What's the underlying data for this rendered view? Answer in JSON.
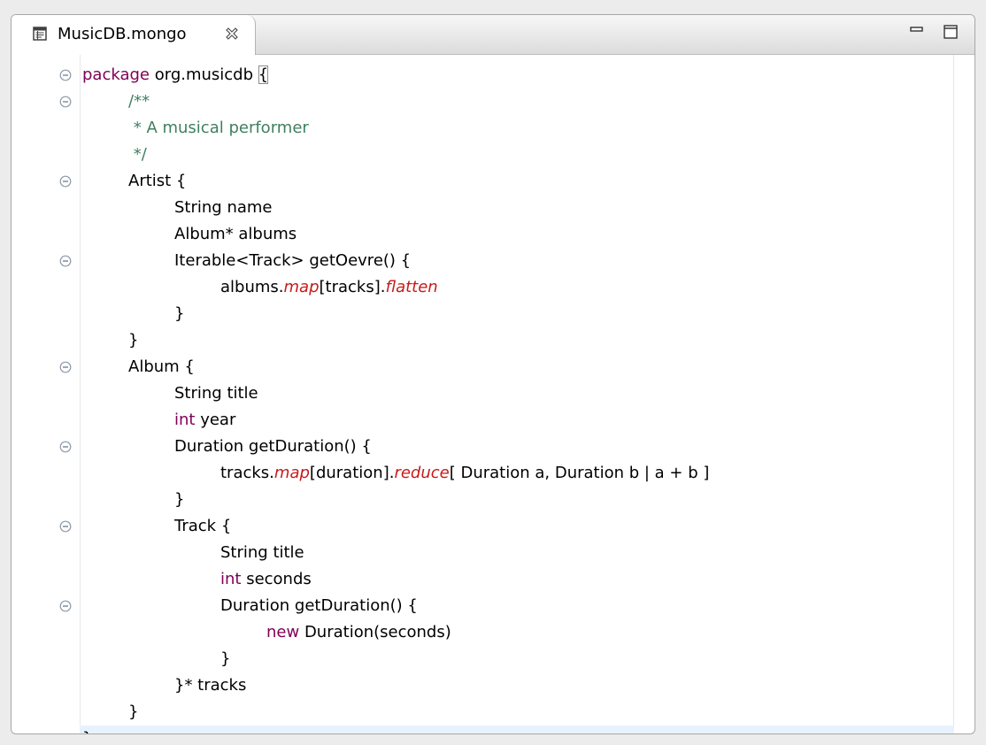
{
  "editor": {
    "tab": {
      "title": "MusicDB.mongo",
      "file_icon": "file-icon",
      "close_icon": "close-icon"
    },
    "window_controls": [
      {
        "name": "minimize-icon"
      },
      {
        "name": "maximize-icon"
      }
    ],
    "colors": {
      "keyword": "#7f0055",
      "comment": "#3f7f5f",
      "extension_method": "#c81a1a",
      "current_line": "#e8f2fe"
    },
    "code_lines": [
      {
        "indent": 0,
        "fold": true,
        "parts": [
          {
            "t": "package",
            "c": "kw"
          },
          {
            "t": " org.musicdb "
          },
          {
            "t": "{",
            "c": "bracket-match"
          }
        ]
      },
      {
        "indent": 1,
        "fold": true,
        "parts": [
          {
            "t": "/**",
            "c": "cm"
          }
        ]
      },
      {
        "indent": 1,
        "fold": false,
        "parts": [
          {
            "t": " * A musical performer",
            "c": "cm"
          }
        ]
      },
      {
        "indent": 1,
        "fold": false,
        "parts": [
          {
            "t": " */",
            "c": "cm"
          }
        ]
      },
      {
        "indent": 1,
        "fold": true,
        "parts": [
          {
            "t": "Artist {"
          }
        ]
      },
      {
        "indent": 2,
        "fold": false,
        "parts": [
          {
            "t": "String name"
          }
        ]
      },
      {
        "indent": 2,
        "fold": false,
        "parts": [
          {
            "t": "Album* albums"
          }
        ]
      },
      {
        "indent": 2,
        "fold": true,
        "parts": [
          {
            "t": "Iterable<Track> getOevre() {"
          }
        ]
      },
      {
        "indent": 3,
        "fold": false,
        "parts": [
          {
            "t": "albums."
          },
          {
            "t": "map",
            "c": "ext"
          },
          {
            "t": "[tracks]."
          },
          {
            "t": "flatten",
            "c": "ext"
          }
        ]
      },
      {
        "indent": 2,
        "fold": false,
        "parts": [
          {
            "t": "}"
          }
        ]
      },
      {
        "indent": 1,
        "fold": false,
        "parts": [
          {
            "t": "}"
          }
        ]
      },
      {
        "indent": 1,
        "fold": true,
        "parts": [
          {
            "t": "Album {"
          }
        ]
      },
      {
        "indent": 2,
        "fold": false,
        "parts": [
          {
            "t": "String title"
          }
        ]
      },
      {
        "indent": 2,
        "fold": false,
        "parts": [
          {
            "t": "int",
            "c": "kw"
          },
          {
            "t": " year"
          }
        ]
      },
      {
        "indent": 2,
        "fold": true,
        "parts": [
          {
            "t": "Duration getDuration() {"
          }
        ]
      },
      {
        "indent": 3,
        "fold": false,
        "parts": [
          {
            "t": "tracks."
          },
          {
            "t": "map",
            "c": "ext"
          },
          {
            "t": "[duration]."
          },
          {
            "t": "reduce",
            "c": "ext"
          },
          {
            "t": "[ Duration a, Duration b | a + b ]"
          }
        ]
      },
      {
        "indent": 2,
        "fold": false,
        "parts": [
          {
            "t": "}"
          }
        ]
      },
      {
        "indent": 2,
        "fold": true,
        "parts": [
          {
            "t": "Track {"
          }
        ]
      },
      {
        "indent": 3,
        "fold": false,
        "parts": [
          {
            "t": "String title"
          }
        ]
      },
      {
        "indent": 3,
        "fold": false,
        "parts": [
          {
            "t": "int",
            "c": "kw"
          },
          {
            "t": " seconds"
          }
        ]
      },
      {
        "indent": 3,
        "fold": true,
        "parts": [
          {
            "t": "Duration getDuration() {"
          }
        ]
      },
      {
        "indent": 4,
        "fold": false,
        "parts": [
          {
            "t": "new",
            "c": "kw"
          },
          {
            "t": " Duration(seconds)"
          }
        ]
      },
      {
        "indent": 3,
        "fold": false,
        "parts": [
          {
            "t": "}"
          }
        ]
      },
      {
        "indent": 2,
        "fold": false,
        "parts": [
          {
            "t": "}* tracks"
          }
        ]
      },
      {
        "indent": 1,
        "fold": false,
        "parts": [
          {
            "t": "}"
          }
        ]
      },
      {
        "indent": 0,
        "fold": false,
        "current": true,
        "parts": [
          {
            "t": "}"
          }
        ]
      }
    ]
  }
}
